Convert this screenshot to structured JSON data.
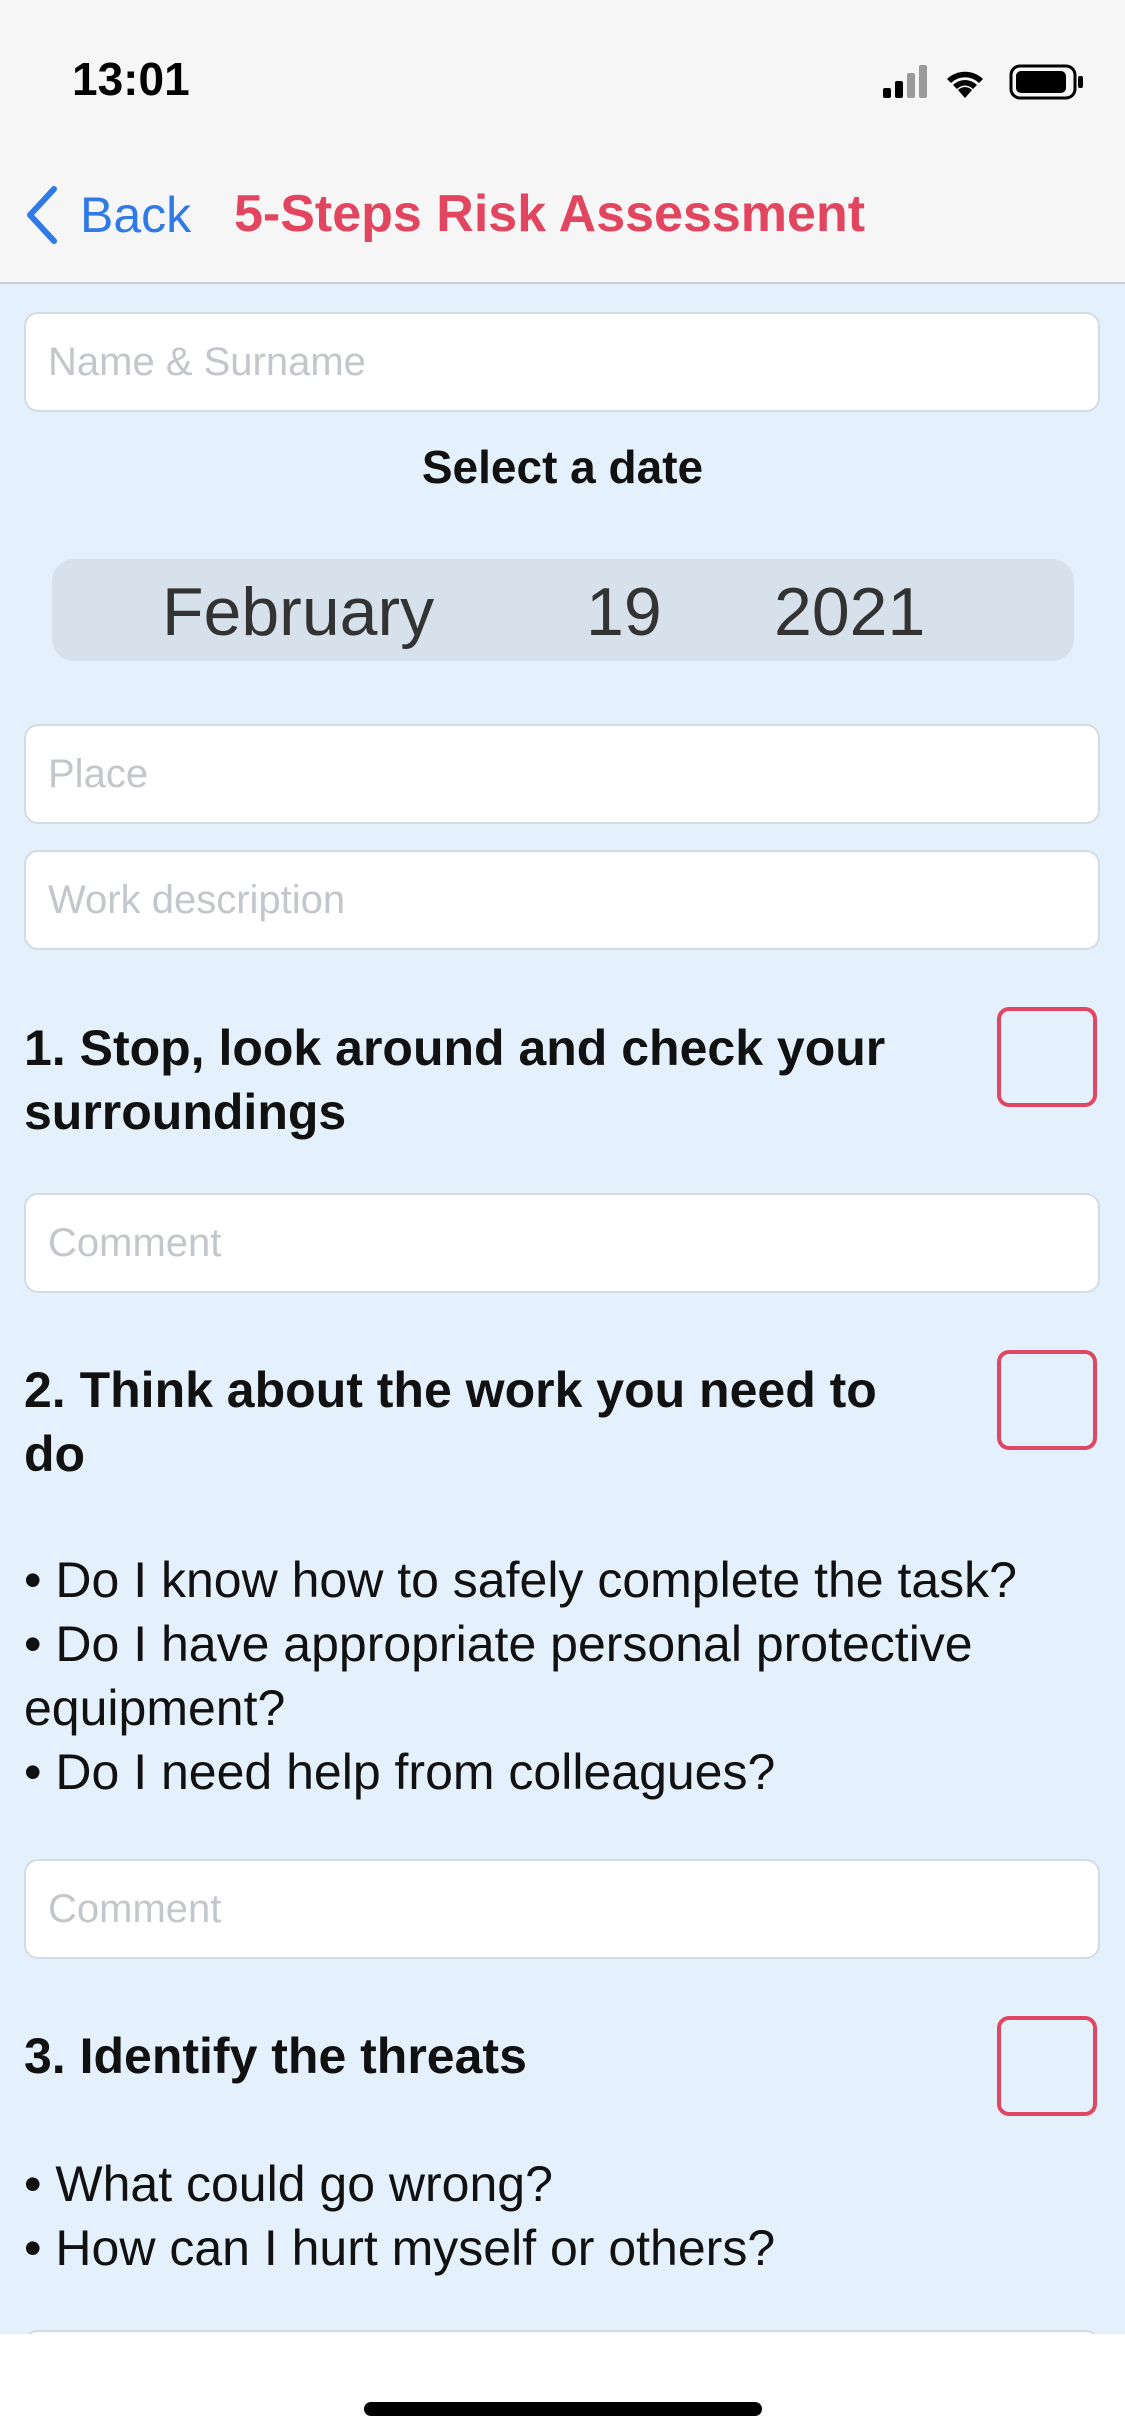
{
  "status_bar": {
    "time": "13:01",
    "icons": [
      "cellular-signal-icon",
      "wifi-icon",
      "battery-icon"
    ]
  },
  "nav": {
    "back_label": "Back",
    "title": "5-Steps Risk Assessment"
  },
  "form": {
    "name_placeholder": "Name & Surname",
    "date_label": "Select a date",
    "date": {
      "month": "February",
      "day": "19",
      "year": "2021"
    },
    "place_placeholder": "Place",
    "work_placeholder": "Work description"
  },
  "steps": [
    {
      "title": "1. Stop, look around and check your surroundings",
      "checked": false,
      "comment_placeholder": "Comment"
    },
    {
      "title": "2. Think about the work you need to do",
      "checked": false,
      "bullets": [
        "• Do I know how to safely complete the task?",
        "• Do I have appropriate personal protective equipment?",
        "• Do I need help from colleagues?"
      ],
      "comment_placeholder": "Comment"
    },
    {
      "title": "3. Identify the threats",
      "checked": false,
      "bullets": [
        "• What could go wrong?",
        "• How can I hurt myself or others?"
      ]
    }
  ],
  "colors": {
    "accent_red": "#e24560",
    "link_blue": "#2f7ae5",
    "background": "#e4f0fb"
  }
}
